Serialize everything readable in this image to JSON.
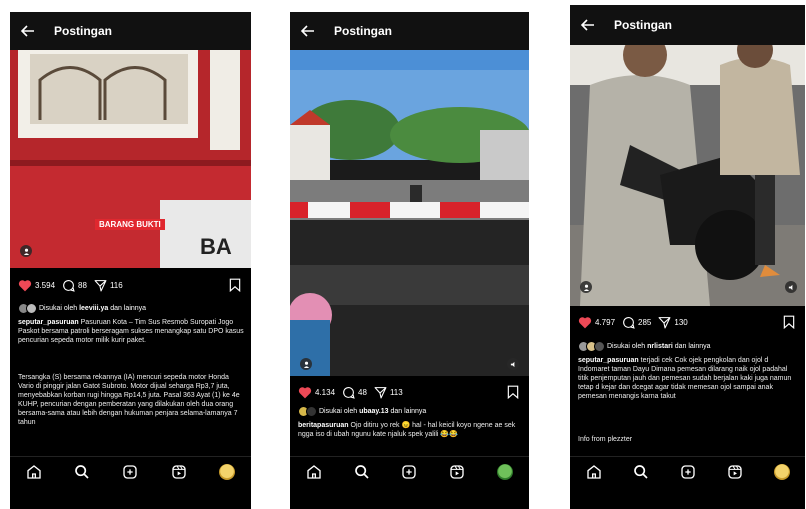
{
  "posts": [
    {
      "header_title": "Postingan",
      "overlay_text": "BARANG BUKTI",
      "likes": "3.594",
      "comments": "88",
      "shares": "116",
      "liked_by_prefix": "Disukai oleh",
      "liked_by_user": "leeviii.ya",
      "liked_by_suffix": "dan lainnya",
      "caption_user": "seputar_pasuruan",
      "caption_text": "Pasuruan Kota – Tim Sus Resmob Suropati Jogo Paskot bersama patroli berseragam sukses menangkap satu DPO kasus pencurian sepeda motor milik kurir paket.",
      "caption_text_2": "Tersangka (S) bersama rekannya (IA) mencuri sepeda motor Honda Vario di pinggir jalan Gatot Subroto. Motor dijual seharga Rp3,7 juta, menyebabkan korban rugi hingga Rp14,5 juta. Pasal 363 Ayat (1) ke 4e KUHP, pencurian dengan pemberatan yang dilakukan oleh dua orang bersama-sama atau lebih dengan hukuman penjara selama-lamanya 7 tahun"
    },
    {
      "header_title": "Postingan",
      "likes": "4.134",
      "comments": "48",
      "shares": "113",
      "liked_by_prefix": "Disukai oleh",
      "liked_by_user": "ubaay.13",
      "liked_by_suffix": "dan lainnya",
      "caption_user": "beritapasuruan",
      "caption_text": "Ojo ditiru yo rek 😠 hal - hal keicil koyo ngene ae sek ngga iso di ubah ngunu kate njaluk spek yalili 😂😂"
    },
    {
      "header_title": "Postingan",
      "likes": "4.797",
      "comments": "285",
      "shares": "130",
      "liked_by_prefix": "Disukai oleh",
      "liked_by_user": "nrlistari",
      "liked_by_suffix": "dan lainnya",
      "caption_user": "seputar_pasuruan",
      "caption_text": "terjadi cek Cok ojek pengkolan dan ojol d Indomaret taman Dayu Dimana pemesan dilarang naik ojol padahal titik penjemputan jauh dan pemesan sudah berjalan kaki juga namun tetap d kejar dan dcegat agar tidak memesan ojol sampai anak pemesan menangis karna takut",
      "caption_text_2": "Info from plezzter"
    }
  ],
  "icons": {
    "back": "arrow-left-icon",
    "like": "heart-icon",
    "comment": "comment-icon",
    "share": "send-icon",
    "save": "bookmark-icon",
    "home": "home-icon",
    "search": "search-icon",
    "create": "plus-square-icon",
    "reels": "reels-icon"
  },
  "colors": {
    "like": "#ed4956",
    "background": "#000000"
  }
}
